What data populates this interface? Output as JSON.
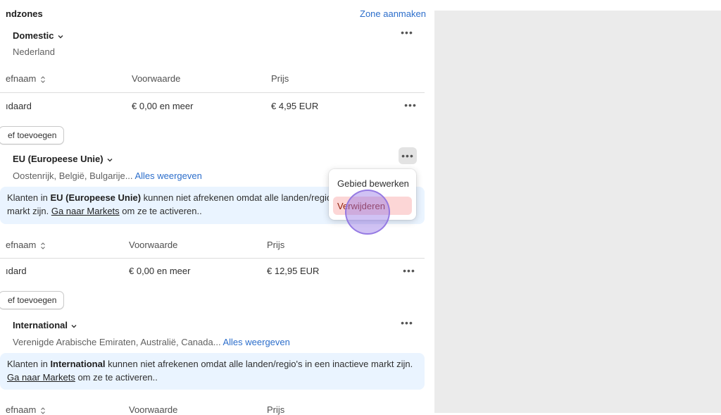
{
  "header": {
    "title": "ndzones",
    "create_zone": "Zone aanmaken"
  },
  "zones": [
    {
      "name": "Domestic",
      "countries": "Nederland",
      "more_link": "",
      "table": {
        "col_rate": "efnaam",
        "col_condition": "Voorwaarde",
        "col_price": "Prijs",
        "rows": [
          {
            "rate": "ıdaard",
            "condition": "€ 0,00 en meer",
            "price": "€ 4,95 EUR"
          }
        ]
      },
      "add_button": "ef toevoegen"
    },
    {
      "name": "EU (Europeese Unie)",
      "countries": "Oostenrijk, België, Bulgarije...",
      "more_link": "Alles weergeven",
      "banner": {
        "line1_pre": "Klanten in ",
        "line1_bold": "EU (Europeese Unie)",
        "line1_post": " kunnen niet afrekenen omdat alle landen/regio's",
        "line2_pre": "markt zijn. ",
        "line2_link": "Ga naar Markets",
        "line2_post": " om ze te activeren.."
      },
      "table": {
        "col_rate": "efnaam",
        "col_condition": "Voorwaarde",
        "col_price": "Prijs",
        "rows": [
          {
            "rate": "ıdard",
            "condition": "€ 0,00 en meer",
            "price": "€ 12,95 EUR"
          }
        ]
      },
      "add_button": "ef toevoegen"
    },
    {
      "name": "International",
      "countries": "Verenigde Arabische Emiraten, Australië, Canada...",
      "more_link": "Alles weergeven",
      "banner": {
        "line1_pre": "Klanten in ",
        "line1_bold": "International",
        "line1_post": " kunnen niet afrekenen omdat alle landen/regio's in een inactieve markt zijn.",
        "line2_pre": "",
        "line2_link": "Ga naar Markets",
        "line2_post": " om ze te activeren.."
      },
      "table": {
        "col_rate": "efnaam",
        "col_condition": "Voorwaarde",
        "col_price": "Prijs"
      }
    }
  ],
  "context_menu": {
    "edit": "Gebied bewerken",
    "delete": "Verwijderen"
  },
  "icons": {
    "more": "more-horizontal-icon",
    "chevron": "chevron-down-icon",
    "sort": "sort-icon"
  },
  "colors": {
    "link": "#2c6ecb",
    "banner_bg": "#eaf4ff",
    "danger_bg": "#fcd6d6",
    "cursor": "#9678e6"
  }
}
